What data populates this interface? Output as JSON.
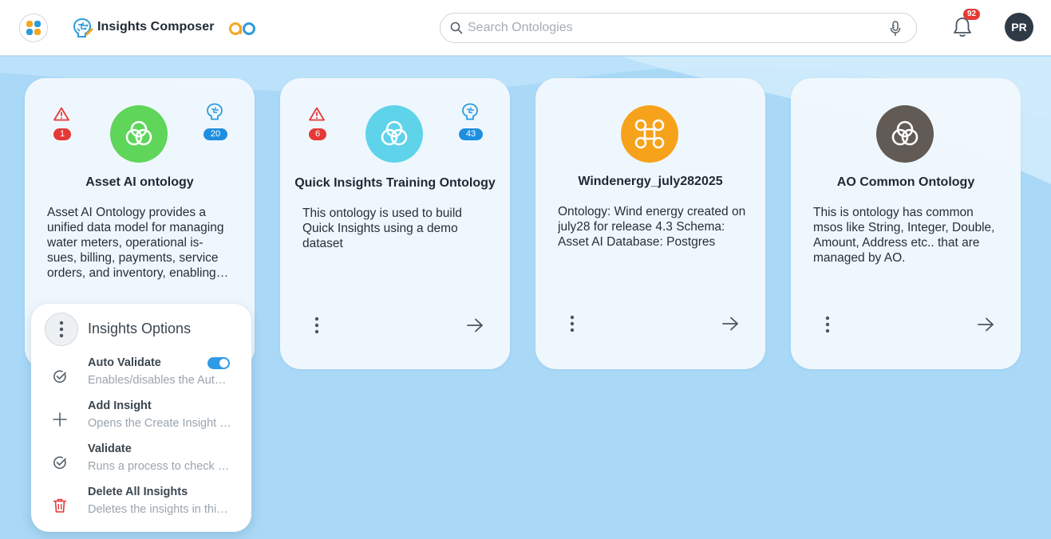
{
  "header": {
    "app_title": "Insights Composer",
    "ao_logo_text": "ao",
    "search_placeholder": "Search Ontologies",
    "notification_count": "92",
    "user_initials": "PR"
  },
  "cards": [
    {
      "title": "Asset AI ontology",
      "description": "Asset AI Ontology provides a unified data model for managing water meters, operational is- sues, billing, payments, service orders, and inventory, enabling efficient operations.",
      "warning_count": "1",
      "insight_count": "20",
      "avatar_color": "#5fd55a",
      "avatar_icon": "venn-icon"
    },
    {
      "title": "Quick Insights Training Ontology",
      "description": "This ontology is used to build Quick Insights using a demo dataset",
      "warning_count": "6",
      "insight_count": "43",
      "avatar_color": "#5ed3ea",
      "avatar_icon": "venn-icon"
    },
    {
      "title": "Windenergy_july282025",
      "description": "Ontology: Wind energy created on july28 for release 4.3 Schema: Asset AI Database: Postgres",
      "avatar_color": "#f7a21b",
      "avatar_icon": "drone-icon"
    },
    {
      "title": "AO Common Ontology",
      "description": "This is ontology has common msos like String, Integer, Double, Amount, Address etc.. that are managed by AO.",
      "avatar_color": "#615a55",
      "avatar_icon": "venn-icon"
    }
  ],
  "options_menu": {
    "title": "Insights Options",
    "items": [
      {
        "label": "Auto Validate",
        "subtitle": "Enables/disables the Auto Validate feature",
        "icon": "check-circle-icon",
        "toggle_on": true
      },
      {
        "label": "Add Insight",
        "subtitle": "Opens the Create Insight dialog",
        "icon": "plus-icon"
      },
      {
        "label": "Validate",
        "subtitle": "Runs a process to check insights",
        "icon": "check-circle-icon"
      },
      {
        "label": "Delete All Insights",
        "subtitle": "Deletes the insights in this ontology",
        "icon": "trash-icon"
      }
    ]
  },
  "colors": {
    "accent_blue": "#1e8fe0",
    "danger_red": "#e53935",
    "background": "#a9d9f7"
  }
}
